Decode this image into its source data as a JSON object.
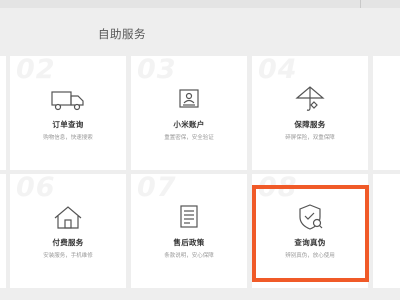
{
  "section": {
    "title": "自助服务"
  },
  "cards": [
    {
      "number": "02",
      "icon": "truck-icon",
      "title": "订单查询",
      "desc": "购物信息，快速搜索"
    },
    {
      "number": "03",
      "icon": "id-card-icon",
      "title": "小米账户",
      "desc": "重置密保，安全验证"
    },
    {
      "number": "04",
      "icon": "umbrella-icon",
      "title": "保障服务",
      "desc": "碎屏保险，双重保障"
    },
    {
      "number": "06",
      "icon": "house-icon",
      "title": "付费服务",
      "desc": "安装服务，手机维修"
    },
    {
      "number": "07",
      "icon": "document-icon",
      "title": "售后政策",
      "desc": "条款说明，安心保障"
    },
    {
      "number": "08",
      "icon": "shield-search-icon",
      "title": "查询真伪",
      "desc": "辨别真伪，放心使用"
    }
  ],
  "colors": {
    "background": "#eeeeee",
    "card": "#ffffff",
    "highlight": "#f05a28",
    "icon_stroke": "#555555"
  }
}
